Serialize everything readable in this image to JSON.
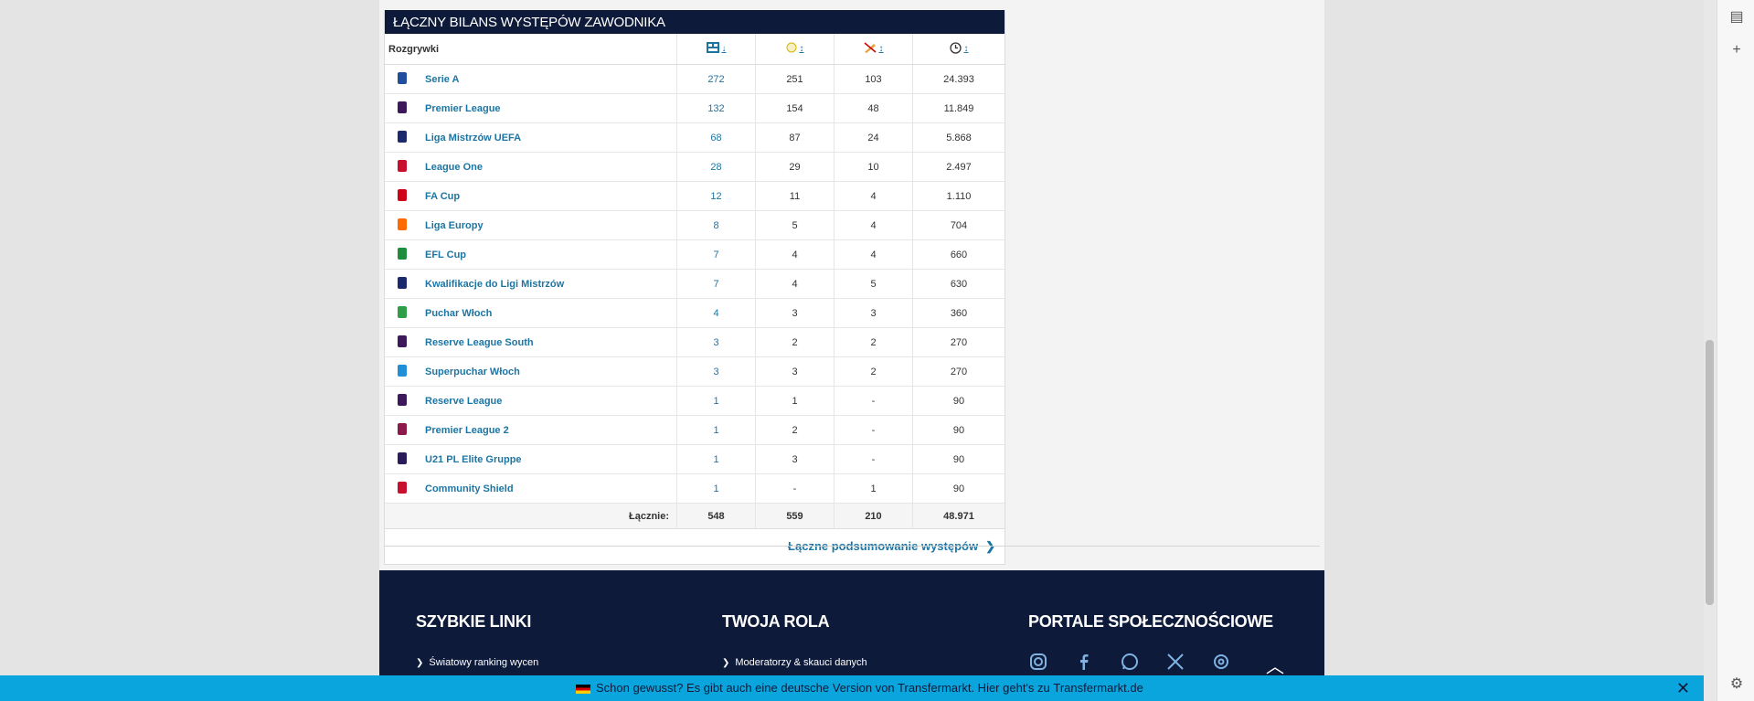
{
  "section_title": "Łączny bilans występów zawodnika",
  "table": {
    "col_competition": "Rozgrywki",
    "col_apps_sort": "↓",
    "col_goals_sort": "↕",
    "col_assists_sort": "↕",
    "col_minutes_sort": "↕",
    "rows": [
      {
        "name": "Serie A",
        "apps": "272",
        "goals": "251",
        "assists": "103",
        "minutes": "24.393",
        "logo_color": "#1f4e9c"
      },
      {
        "name": "Premier League",
        "apps": "132",
        "goals": "154",
        "assists": "48",
        "minutes": "11.849",
        "logo_color": "#3d195b"
      },
      {
        "name": "Liga Mistrzów UEFA",
        "apps": "68",
        "goals": "87",
        "assists": "24",
        "minutes": "5.868",
        "logo_color": "#1a2a6c"
      },
      {
        "name": "League One",
        "apps": "28",
        "goals": "29",
        "assists": "10",
        "minutes": "2.497",
        "logo_color": "#c8102e"
      },
      {
        "name": "FA Cup",
        "apps": "12",
        "goals": "11",
        "assists": "4",
        "minutes": "1.110",
        "logo_color": "#d0021b"
      },
      {
        "name": "Liga Europy",
        "apps": "8",
        "goals": "5",
        "assists": "4",
        "minutes": "704",
        "logo_color": "#ff6a00"
      },
      {
        "name": "EFL Cup",
        "apps": "7",
        "goals": "4",
        "assists": "4",
        "minutes": "660",
        "logo_color": "#1e8e3e"
      },
      {
        "name": "Kwalifikacje do Ligi Mistrzów",
        "apps": "7",
        "goals": "4",
        "assists": "5",
        "minutes": "630",
        "logo_color": "#1a2a6c"
      },
      {
        "name": "Puchar Włoch",
        "apps": "4",
        "goals": "3",
        "assists": "3",
        "minutes": "360",
        "logo_color": "#2e9e48"
      },
      {
        "name": "Reserve League South",
        "apps": "3",
        "goals": "2",
        "assists": "2",
        "minutes": "270",
        "logo_color": "#3d195b"
      },
      {
        "name": "Superpuchar Włoch",
        "apps": "3",
        "goals": "3",
        "assists": "2",
        "minutes": "270",
        "logo_color": "#1f8fd6"
      },
      {
        "name": "Reserve League",
        "apps": "1",
        "goals": "1",
        "assists": "-",
        "minutes": "90",
        "logo_color": "#3d195b"
      },
      {
        "name": "Premier League 2",
        "apps": "1",
        "goals": "2",
        "assists": "-",
        "minutes": "90",
        "logo_color": "#8b1a4a"
      },
      {
        "name": "U21 PL Elite Gruppe",
        "apps": "1",
        "goals": "3",
        "assists": "-",
        "minutes": "90",
        "logo_color": "#2b1b5a"
      },
      {
        "name": "Community Shield",
        "apps": "1",
        "goals": "-",
        "assists": "1",
        "minutes": "90",
        "logo_color": "#c8102e"
      }
    ],
    "totals_label": "Łącznie:",
    "totals": {
      "apps": "548",
      "goals": "559",
      "assists": "210",
      "minutes": "48.971"
    }
  },
  "summary_link": "Łączne podsumowanie występów",
  "footer": {
    "quick_links_title": "SZYBKIE LINKI",
    "quick_link_1": "Światowy ranking wycen",
    "role_title": "TWOJA ROLA",
    "role_link_1": "Moderatorzy & skauci danych",
    "social_title": "PORTALE SPOŁECZNOŚCIOWE"
  },
  "banner": {
    "text": "Schon gewusst? Es gibt auch eine deutsche Version von Transfermarkt. Hier geht's zu",
    "link": "Transfermarkt.de"
  },
  "colors": {
    "navy": "#0d1a3a",
    "link": "#1d75a3",
    "banner": "#0aa5dc"
  }
}
